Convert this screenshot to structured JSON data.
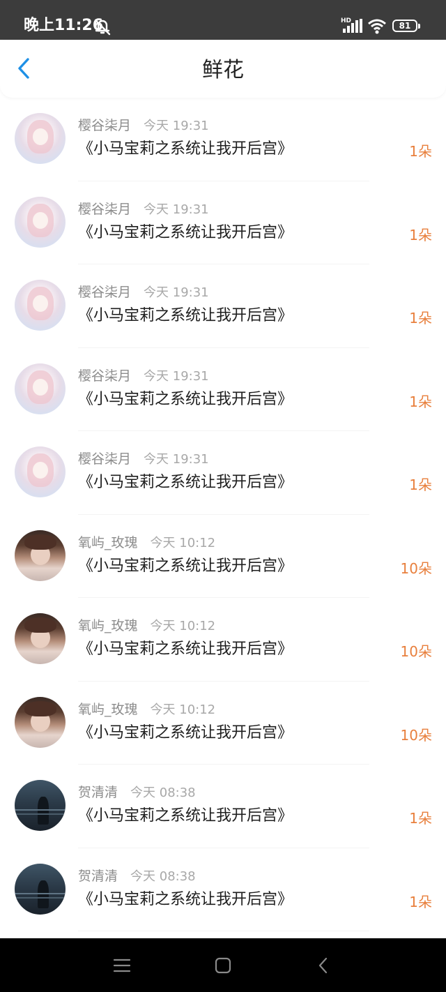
{
  "status_bar": {
    "time": "晚上11:26",
    "network_label": "HD",
    "battery": "81",
    "icons": [
      "mute-bell-icon",
      "signal-icon",
      "wifi-icon",
      "battery-icon"
    ]
  },
  "header": {
    "title": "鲜花",
    "back_icon": "chevron-left-icon",
    "accent_color": "#1e90e6"
  },
  "list": {
    "items": [
      {
        "user": "樱谷柒月",
        "time": "今天 19:31",
        "book": "《小马宝莉之系统让我开后宫》",
        "count": "1朵",
        "avatar": "pastel"
      },
      {
        "user": "樱谷柒月",
        "time": "今天 19:31",
        "book": "《小马宝莉之系统让我开后宫》",
        "count": "1朵",
        "avatar": "pastel"
      },
      {
        "user": "樱谷柒月",
        "time": "今天 19:31",
        "book": "《小马宝莉之系统让我开后宫》",
        "count": "1朵",
        "avatar": "pastel"
      },
      {
        "user": "樱谷柒月",
        "time": "今天 19:31",
        "book": "《小马宝莉之系统让我开后宫》",
        "count": "1朵",
        "avatar": "pastel"
      },
      {
        "user": "樱谷柒月",
        "time": "今天 19:31",
        "book": "《小马宝莉之系统让我开后宫》",
        "count": "1朵",
        "avatar": "pastel"
      },
      {
        "user": "氧屿_玫瑰",
        "time": "今天 10:12",
        "book": "《小马宝莉之系统让我开后宫》",
        "count": "10朵",
        "avatar": "brown"
      },
      {
        "user": "氧屿_玫瑰",
        "time": "今天 10:12",
        "book": "《小马宝莉之系统让我开后宫》",
        "count": "10朵",
        "avatar": "brown"
      },
      {
        "user": "氧屿_玫瑰",
        "time": "今天 10:12",
        "book": "《小马宝莉之系统让我开后宫》",
        "count": "10朵",
        "avatar": "brown"
      },
      {
        "user": "贺清清",
        "time": "今天 08:38",
        "book": "《小马宝莉之系统让我开后宫》",
        "count": "1朵",
        "avatar": "night"
      },
      {
        "user": "贺清清",
        "time": "今天 08:38",
        "book": "《小马宝莉之系统让我开后宫》",
        "count": "1朵",
        "avatar": "night"
      }
    ],
    "count_color": "#e87f3c"
  },
  "nav_bar": {
    "icons": [
      "menu-icon",
      "home-icon",
      "back-icon"
    ]
  }
}
